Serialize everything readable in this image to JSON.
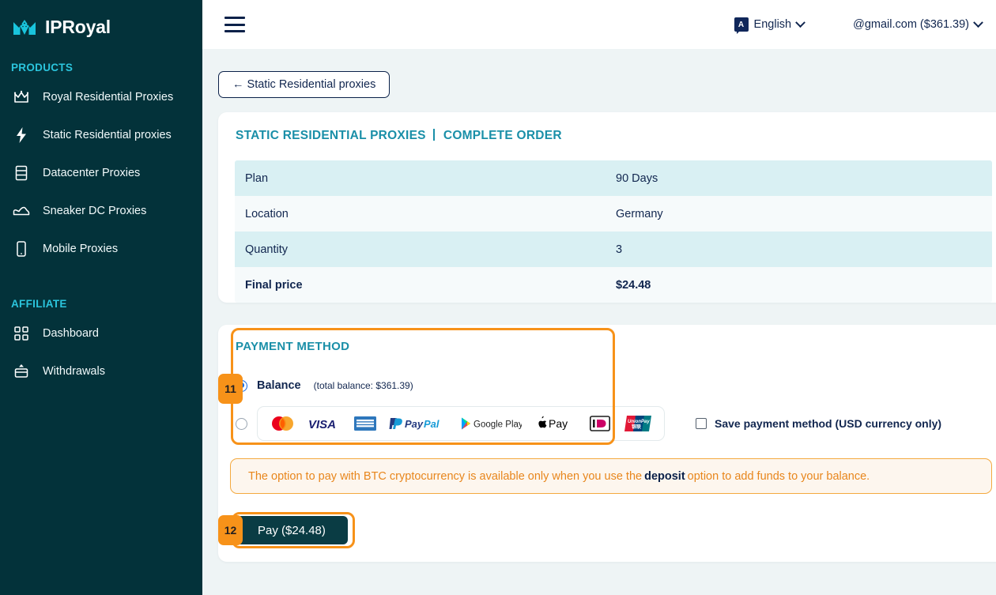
{
  "brand": {
    "name": "IPRoyal",
    "logo_icon": "crown-mountain-logo"
  },
  "sidebar": {
    "sections": [
      {
        "label": "PRODUCTS",
        "items": [
          {
            "label": "Royal Residential Proxies",
            "icon": "crown-icon"
          },
          {
            "label": "Static Residential proxies",
            "icon": "bolt-icon"
          },
          {
            "label": "Datacenter Proxies",
            "icon": "server-icon"
          },
          {
            "label": "Sneaker DC Proxies",
            "icon": "sneaker-icon"
          },
          {
            "label": "Mobile Proxies",
            "icon": "mobile-icon"
          }
        ]
      },
      {
        "label": "AFFILIATE",
        "items": [
          {
            "label": "Dashboard",
            "icon": "grid-icon"
          },
          {
            "label": "Withdrawals",
            "icon": "withdraw-icon"
          }
        ]
      }
    ]
  },
  "topbar": {
    "menu_icon": "hamburger-icon",
    "language": "English",
    "language_icon": "translate-icon",
    "account": "@gmail.com ($361.39)",
    "chevron_icon": "chevron-down-icon"
  },
  "content": {
    "back_button": "← Static Residential proxies",
    "order_card": {
      "title_primary": "STATIC RESIDENTIAL PROXIES",
      "title_secondary": "COMPLETE ORDER",
      "rows": [
        {
          "label": "Plan",
          "value": "90 Days"
        },
        {
          "label": "Location",
          "value": "Germany"
        },
        {
          "label": "Quantity",
          "value": "3"
        },
        {
          "label": "Final price",
          "value": "$24.48"
        }
      ]
    },
    "payment": {
      "title": "PAYMENT METHOD",
      "balance_label": "Balance",
      "balance_detail": "(total balance: $361.39)",
      "balance_selected": true,
      "card_logos": [
        "mastercard",
        "visa",
        "amex",
        "paypal",
        "google-play",
        "apple-pay",
        "ideal",
        "unionpay"
      ],
      "save_method_label": "Save payment method (USD currency only)",
      "save_method_checked": false,
      "btc_note_prefix": "The option to pay with BTC cryptocurrency is available only when you use the",
      "btc_note_link": "deposit",
      "btc_note_suffix": "option to add funds to your balance.",
      "pay_button": "Pay ($24.48)"
    },
    "annotations": [
      {
        "badge": "11",
        "target": "payment-method-group"
      },
      {
        "badge": "12",
        "target": "pay-button"
      }
    ]
  },
  "colors": {
    "sidebar_bg": "#03323a",
    "accent_cyan": "#2bc5dd",
    "heading_teal": "#1a8fa8",
    "annotation_orange": "#f79219",
    "pay_button": "#0a3c44",
    "note_orange": "#e8861c",
    "radio_blue": "#1168e0"
  }
}
